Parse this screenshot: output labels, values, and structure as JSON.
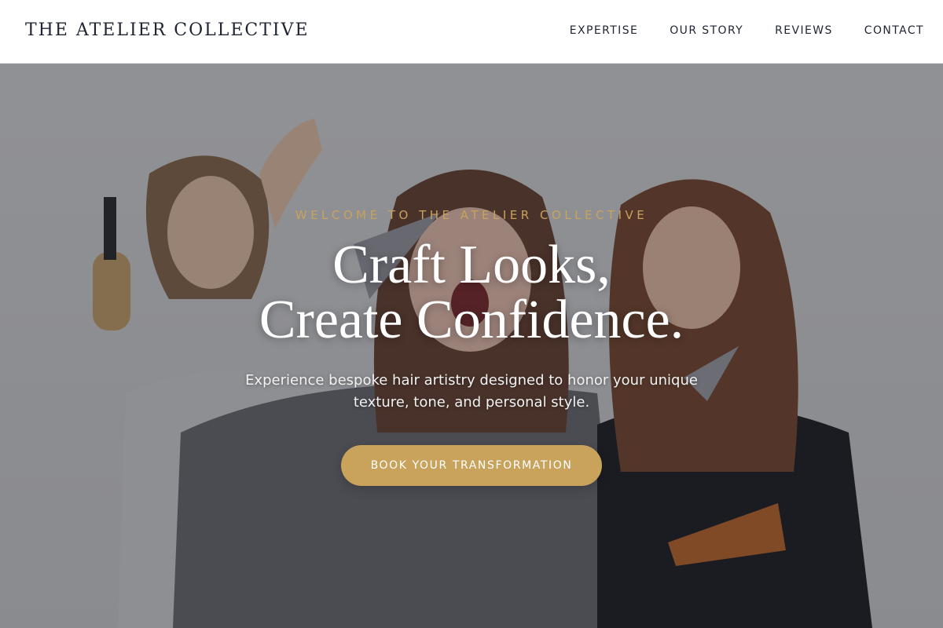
{
  "header": {
    "brand": "THE ATELIER COLLECTIVE",
    "nav": [
      {
        "label": "EXPERTISE"
      },
      {
        "label": "OUR STORY"
      },
      {
        "label": "REVIEWS"
      },
      {
        "label": "CONTACT"
      }
    ]
  },
  "hero": {
    "eyebrow": "WELCOME TO THE ATELIER COLLECTIVE",
    "headline_line1": "Craft Looks,",
    "headline_line2": "Create Confidence.",
    "subtext": "Experience bespoke hair artistry designed to honor your unique texture, tone, and personal style.",
    "cta_label": "BOOK YOUR TRANSFORMATION",
    "photo_icon": "stylists-photo"
  },
  "colors": {
    "accent": "#c9a25c",
    "text_dark": "#1f2433",
    "header_bg": "#ffffff",
    "overlay": "#141822"
  }
}
